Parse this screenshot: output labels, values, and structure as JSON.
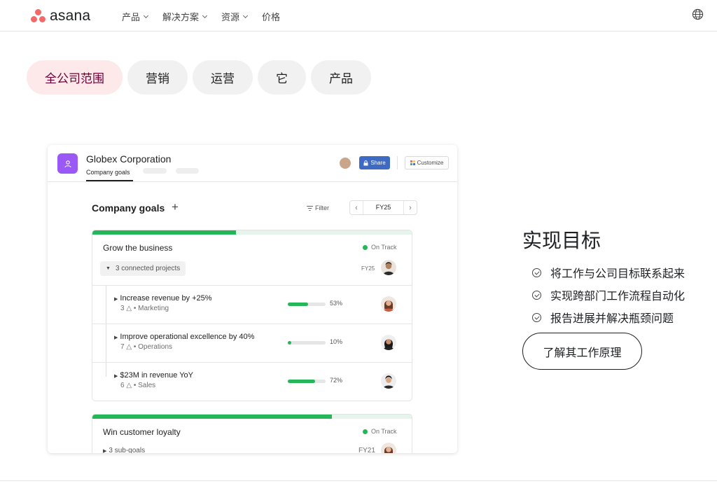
{
  "brand": {
    "name": "asana",
    "accent": "#f06a6a"
  },
  "nav": {
    "items": [
      {
        "label": "产品",
        "has_menu": true
      },
      {
        "label": "解决方案",
        "has_menu": true
      },
      {
        "label": "资源",
        "has_menu": true
      },
      {
        "label": "价格",
        "has_menu": false
      }
    ],
    "language_icon": "globe-icon"
  },
  "pills": [
    {
      "label": "全公司范围",
      "active": true
    },
    {
      "label": "营销",
      "active": false
    },
    {
      "label": "运营",
      "active": false
    },
    {
      "label": "它",
      "active": false
    },
    {
      "label": "产品",
      "active": false
    }
  ],
  "card": {
    "org_name": "Globex Corporation",
    "tab_label": "Company goals",
    "share_label": "Share",
    "customize_label": "Customize",
    "section_title": "Company goals",
    "filter_label": "Filter",
    "period": "FY25",
    "goals": [
      {
        "name": "Grow the business",
        "status": "On Track",
        "progress": 0.45,
        "projects_label": "3 connected projects",
        "period": "FY25",
        "subgoals": [
          {
            "title": "Increase revenue by +25%",
            "count": "3",
            "team": "Marketing",
            "progress": 0.53,
            "pct_label": "53%"
          },
          {
            "title": "Improve operational excellence by 40%",
            "count": "7",
            "team": "Operations",
            "progress": 0.1,
            "pct_label": "10%"
          },
          {
            "title": "$23M in revenue YoY",
            "count": "6",
            "team": "Sales",
            "progress": 0.72,
            "pct_label": "72%"
          }
        ]
      },
      {
        "name": "Win customer loyalty",
        "status": "On Track",
        "progress": 0.75,
        "subgoals_label": "3 sub-goals",
        "period": "FY21"
      }
    ]
  },
  "feature": {
    "title": "实现目标",
    "items": [
      "将工作与公司目标联系起来",
      "实现跨部门工作流程自动化",
      "报告进展并解决瓶颈问题"
    ],
    "cta_label": "了解其工作原理"
  }
}
